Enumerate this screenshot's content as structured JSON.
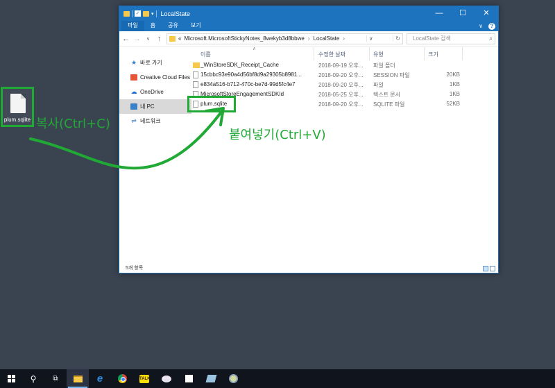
{
  "desktop": {
    "file_icon_label": "plum.sqlite",
    "copy_annotation": "복사(Ctrl+C)",
    "paste_annotation": "붙여넣기(Ctrl+V)",
    "annotation_color": "#21a936"
  },
  "window": {
    "title": "LocalState",
    "controls": {
      "minimize": "—",
      "maximize": "☐",
      "close": "✕"
    },
    "ribbon_tabs": [
      "파일",
      "홈",
      "공유",
      "보기"
    ],
    "ribbon_expand": "∨",
    "help": "?",
    "address": {
      "prefix": "«",
      "segments": [
        "Microsoft.MicrosoftStickyNotes_8wekyb3d8bbwe",
        "LocalState"
      ],
      "separator": "›"
    },
    "search_placeholder": "LocalState 검색",
    "sidebar": [
      {
        "label": "바로 가기",
        "icon": "star-icon"
      },
      {
        "label": "Creative Cloud Files",
        "icon": "creative-cloud-icon"
      },
      {
        "label": "OneDrive",
        "icon": "onedrive-icon"
      },
      {
        "label": "내 PC",
        "icon": "pc-icon",
        "selected": true
      },
      {
        "label": "네트워크",
        "icon": "network-icon"
      }
    ],
    "columns": {
      "name": "이름",
      "modified": "수정한 날짜",
      "type": "유형",
      "size": "크기"
    },
    "files": [
      {
        "name": "_WinStoreSDK_Receipt_Cache",
        "modified": "2018-09-19 오후...",
        "type": "파일 폴더",
        "size": "",
        "kind": "folder"
      },
      {
        "name": "15cbbc93e90a4d56bf8d9a29305b8981...",
        "modified": "2018-09-20 오후...",
        "type": "SESSION 파일",
        "size": "20KB",
        "kind": "file"
      },
      {
        "name": "e834a516-b712-470c-be7d-99d5fc4e7",
        "modified": "2018-09-20 오후...",
        "type": "파일",
        "size": "1KB",
        "kind": "file"
      },
      {
        "name": "MicrosoftStoreEngagementSDKId",
        "modified": "2018-05-25 오후...",
        "type": "텍스트 문서",
        "size": "1KB",
        "kind": "file"
      },
      {
        "name": "plum.sqlite",
        "modified": "2018-09-20 오후...",
        "type": "SQLITE 파일",
        "size": "52KB",
        "kind": "file"
      }
    ],
    "status": "5개 항목"
  },
  "taskbar": {
    "items": [
      "start-icon",
      "search-icon",
      "task-view-icon",
      "file-explorer-icon",
      "edge-icon",
      "chrome-icon",
      "kakaotalk-icon",
      "paint-icon",
      "sticky-notes-icon",
      "book-icon",
      "app-icon"
    ],
    "kakaotalk_label": "TALK"
  }
}
